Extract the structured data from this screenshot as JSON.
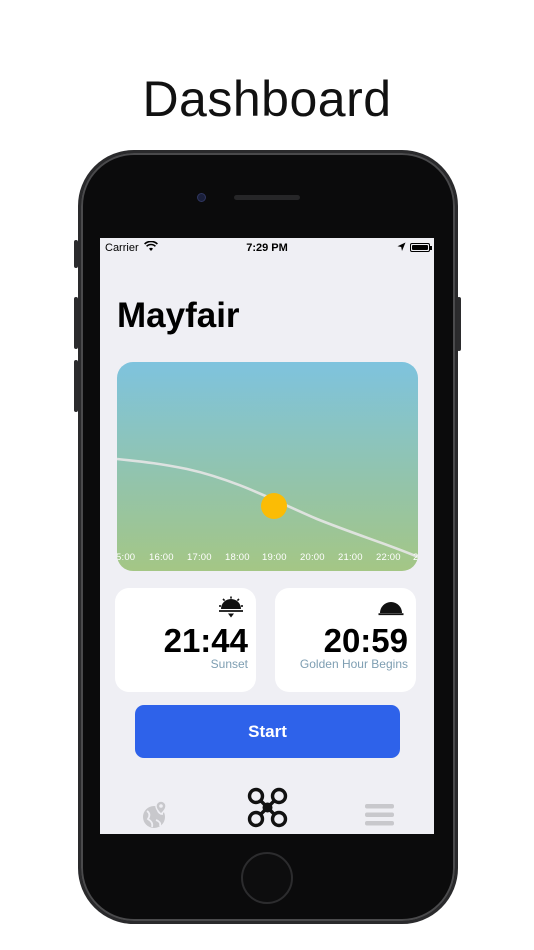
{
  "caption": "Dashboard",
  "status_bar": {
    "carrier": "Carrier",
    "time": "7:29 PM",
    "icons": [
      "wifi-icon",
      "location-arrow-icon",
      "battery-icon"
    ]
  },
  "location_title": "Mayfair",
  "sun_chart": {
    "hour_labels": [
      "5:00",
      "16:00",
      "17:00",
      "18:00",
      "19:00",
      "20:00",
      "21:00",
      "22:00",
      "2"
    ],
    "sun_icon": "sun-icon",
    "colors": {
      "sky_top": "#7ec3de",
      "sky_bottom": "#a4c685",
      "sun": "#fbbc05",
      "path": "#e6e6e6"
    }
  },
  "cards": [
    {
      "time": "21:44",
      "label": "Sunset",
      "icon": "sunset-icon"
    },
    {
      "time": "20:59",
      "label": "Golden Hour Begins",
      "icon": "golden-hour-icon"
    }
  ],
  "start_button": {
    "label": "Start",
    "color": "#2e62ea"
  },
  "tab_bar": {
    "items": [
      {
        "name": "map",
        "icon": "globe-pin-icon",
        "active": false
      },
      {
        "name": "drone",
        "icon": "drone-icon",
        "active": true
      },
      {
        "name": "menu",
        "icon": "menu-icon",
        "active": false
      }
    ]
  }
}
